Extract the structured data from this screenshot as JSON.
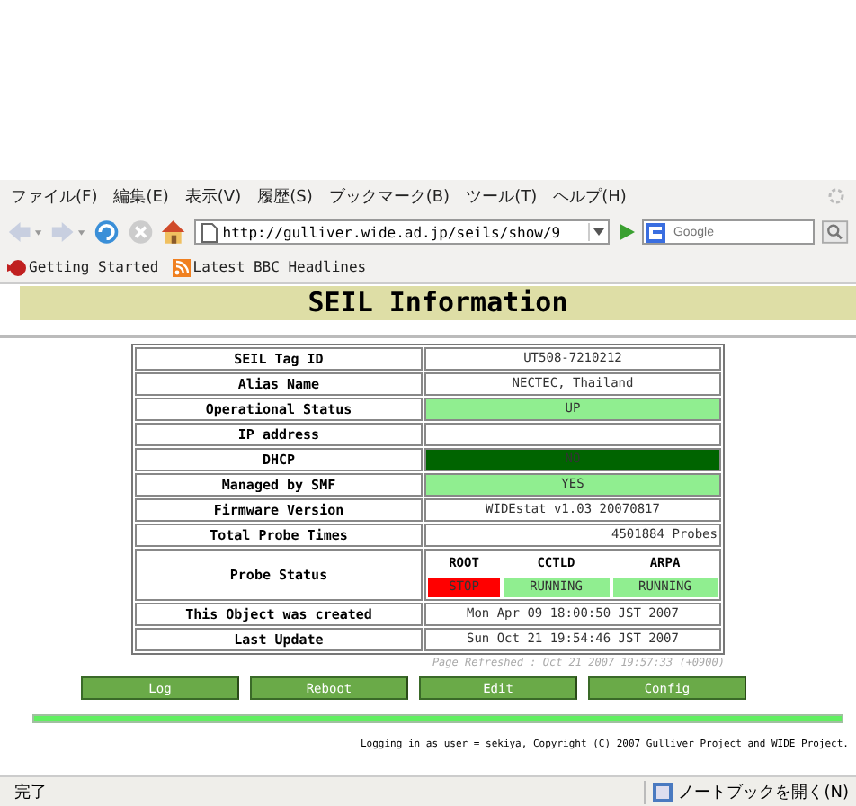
{
  "menu": [
    "ファイル(F)",
    "編集(E)",
    "表示(V)",
    "履歴(S)",
    "ブックマーク(B)",
    "ツール(T)",
    "ヘルプ(H)"
  ],
  "address": {
    "value": "http://gulliver.wide.ad.jp/seils/show/9"
  },
  "search": {
    "placeholder": "Google"
  },
  "bookmarks": [
    "Getting Started",
    "Latest BBC Headlines"
  ],
  "page_title": "SEIL Information",
  "rows": [
    {
      "kind": "text",
      "label": "SEIL Tag ID",
      "value": "UT508-7210212"
    },
    {
      "kind": "text",
      "label": "Alias Name",
      "value": "NECTEC, Thailand"
    },
    {
      "kind": "text",
      "label": "Operational Status",
      "value": "UP",
      "color": "#90ee90"
    },
    {
      "kind": "text",
      "label": "IP address"
    },
    {
      "kind": "text",
      "label": "DHCP",
      "value": "NO",
      "color": "#006400"
    },
    {
      "kind": "text",
      "label": "Managed by SMF",
      "value": "YES",
      "color": "#90ee90"
    },
    {
      "kind": "text",
      "label": "Firmware Version",
      "value": "WIDEstat v1.03 20070817"
    },
    {
      "kind": "right",
      "label": "Total Probe Times",
      "value": "4501884 Probes"
    },
    {
      "kind": "probes",
      "label": "Probe Status",
      "probes": [
        {
          "name": "ROOT",
          "status": "STOP",
          "color": "#ff0000"
        },
        {
          "name": "CCTLD",
          "status": "RUNNING",
          "color": "#90ee90"
        },
        {
          "name": "ARPA",
          "status": "RUNNING",
          "color": "#90ee90"
        }
      ]
    },
    {
      "kind": "text",
      "label": "This Object was created",
      "value": "Mon Apr 09 18:00:50 JST 2007"
    },
    {
      "kind": "text",
      "label": "Last Update",
      "value": "Sun Oct 21 19:54:46 JST 2007"
    }
  ],
  "refreshed": "Page Refreshed : Oct 21 2007 19:57:33 (+0900)",
  "buttons": [
    "Log",
    "Reboot",
    "Edit",
    "Config"
  ],
  "footer": "Logging in as user = sekiya, Copyright (C) 2007 Gulliver Project and WIDE Project.",
  "status_bar": {
    "text": "完了",
    "notebook": "ノートブックを開く(N)"
  }
}
